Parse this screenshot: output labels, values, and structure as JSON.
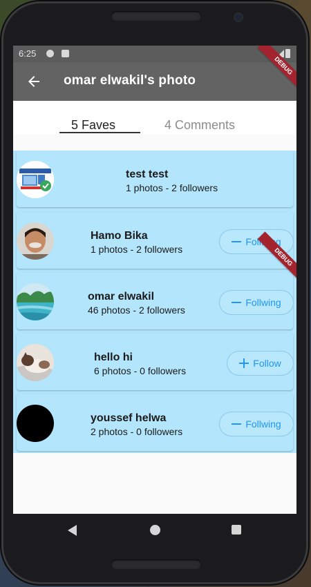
{
  "status_bar": {
    "time": "6:25",
    "debug_banner": "DEBUG"
  },
  "app_bar": {
    "title": "omar elwakil's photo",
    "back_icon": "arrow-left-icon"
  },
  "tabs": [
    {
      "label": "5 Faves",
      "selected": true
    },
    {
      "label": "4 Comments",
      "selected": false
    }
  ],
  "list_debug_banner": "DEBUG",
  "users": [
    {
      "name": "test test",
      "stats": "1 photos - 2 followers",
      "button": null,
      "avatar": "software-test-logo"
    },
    {
      "name": "Hamo Bika",
      "stats": "1 photos - 2 followers",
      "button": "Follwing",
      "avatar": "man-portrait"
    },
    {
      "name": "omar elwakil",
      "stats": "46 photos - 2 followers",
      "button": "Follwing",
      "avatar": "lake-landscape"
    },
    {
      "name": "hello hi",
      "stats": "6 photos - 0 followers",
      "button": "Follow",
      "avatar": "sleeping-cat"
    },
    {
      "name": "youssef helwa",
      "stats": "2 photos - 0 followers",
      "button": "Follwing",
      "avatar": "black-circle"
    }
  ],
  "colors": {
    "app_bar": "#636363",
    "list_background": "#b3e5fc",
    "button_accent": "#2196f3",
    "debug_banner": "#a3242e"
  }
}
